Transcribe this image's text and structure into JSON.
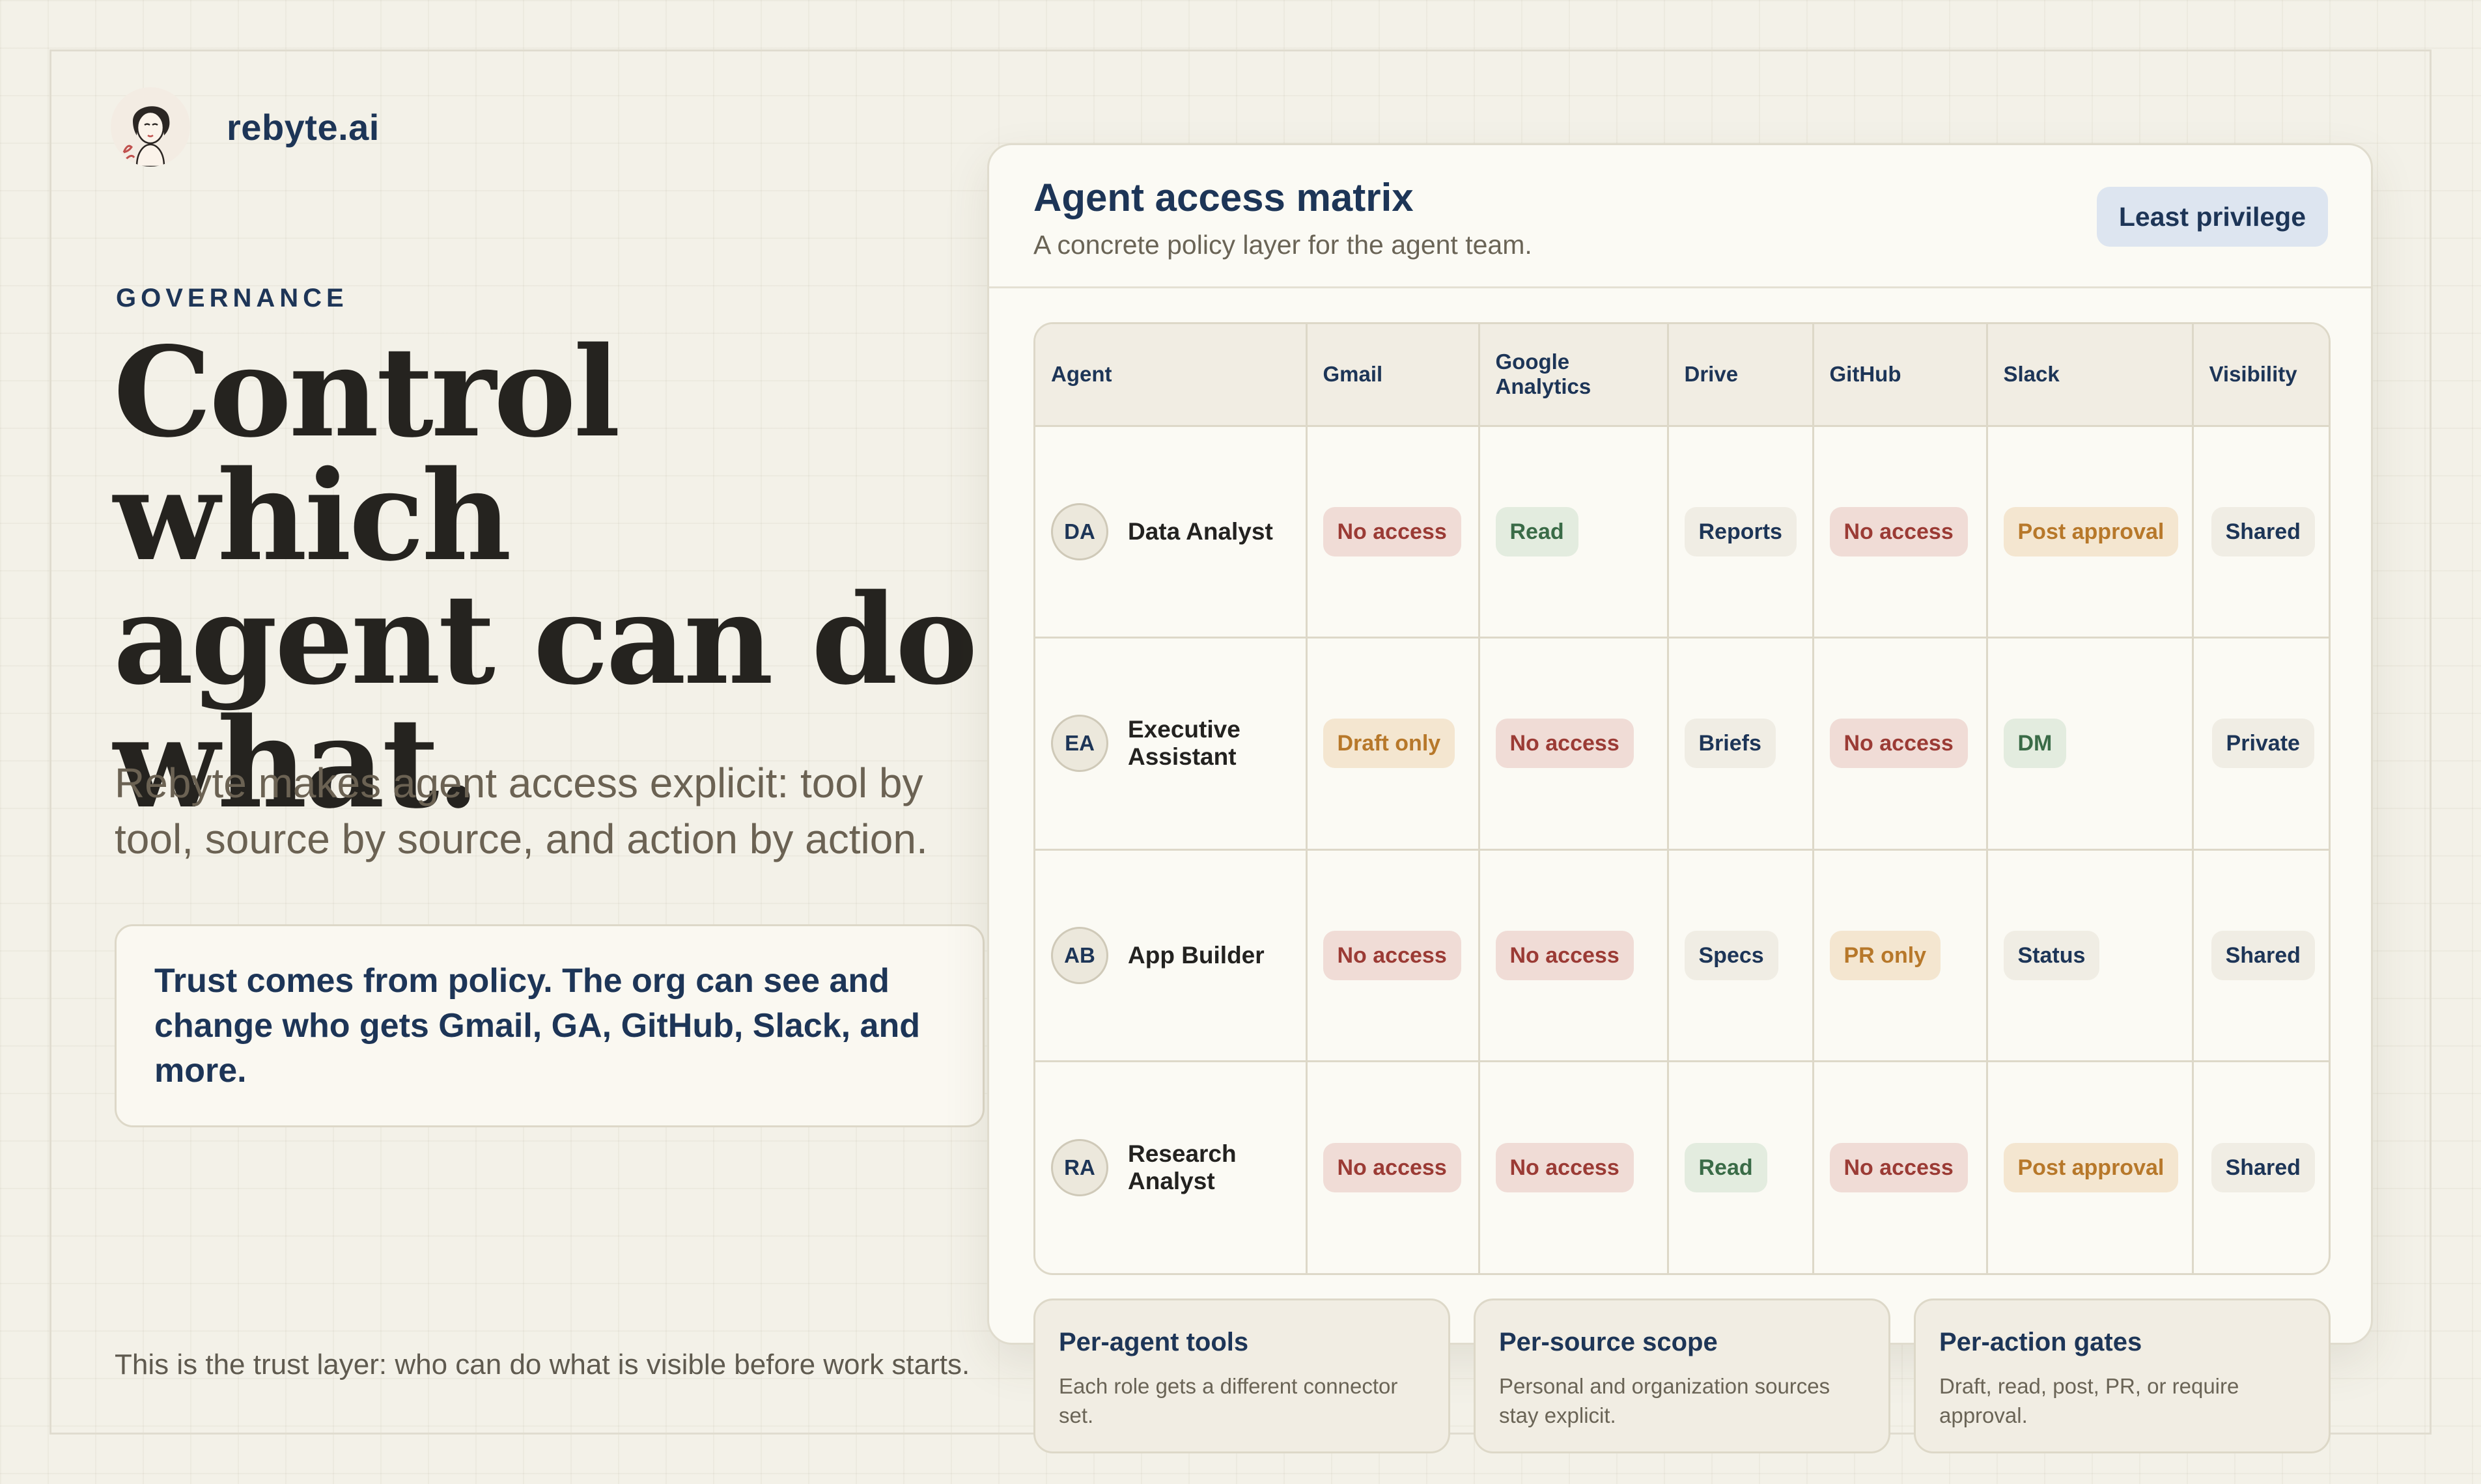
{
  "brand": {
    "name": "rebyte.ai"
  },
  "hero": {
    "eyebrow": "GOVERNANCE",
    "headline_lines": [
      "Control which",
      "agent can do",
      "what."
    ],
    "subhead": "Rebyte makes agent access explicit: tool by tool, source by source, and action by action.",
    "callout": "Trust comes from policy. The org can see and change who gets Gmail, GA, GitHub, Slack, and more.",
    "footnote": "This is the trust layer: who can do what is visible before work starts."
  },
  "card": {
    "title": "Agent access matrix",
    "subtitle": "A concrete policy layer for the agent team.",
    "badge": "Least privilege"
  },
  "matrix": {
    "headers": [
      "Agent",
      "Gmail",
      "Google Analytics",
      "Drive",
      "GitHub",
      "Slack",
      "Visibility"
    ],
    "rows": [
      {
        "initials": "DA",
        "name": "Data Analyst",
        "cells": [
          {
            "label": "No access",
            "tone": "red"
          },
          {
            "label": "Read",
            "tone": "green"
          },
          {
            "label": "Reports",
            "tone": "neutral"
          },
          {
            "label": "No access",
            "tone": "red"
          },
          {
            "label": "Post approval",
            "tone": "orange"
          },
          {
            "label": "Shared",
            "tone": "neutral"
          }
        ]
      },
      {
        "initials": "EA",
        "name": "Executive Assistant",
        "cells": [
          {
            "label": "Draft only",
            "tone": "orange"
          },
          {
            "label": "No access",
            "tone": "red"
          },
          {
            "label": "Briefs",
            "tone": "neutral"
          },
          {
            "label": "No access",
            "tone": "red"
          },
          {
            "label": "DM",
            "tone": "green"
          },
          {
            "label": "Private",
            "tone": "neutral"
          }
        ]
      },
      {
        "initials": "AB",
        "name": "App Builder",
        "cells": [
          {
            "label": "No access",
            "tone": "red"
          },
          {
            "label": "No access",
            "tone": "red"
          },
          {
            "label": "Specs",
            "tone": "neutral"
          },
          {
            "label": "PR only",
            "tone": "orange"
          },
          {
            "label": "Status",
            "tone": "neutral"
          },
          {
            "label": "Shared",
            "tone": "neutral"
          }
        ]
      },
      {
        "initials": "RA",
        "name": "Research Analyst",
        "cells": [
          {
            "label": "No access",
            "tone": "red"
          },
          {
            "label": "No access",
            "tone": "red"
          },
          {
            "label": "Read",
            "tone": "green"
          },
          {
            "label": "No access",
            "tone": "red"
          },
          {
            "label": "Post approval",
            "tone": "orange"
          },
          {
            "label": "Shared",
            "tone": "neutral"
          }
        ]
      }
    ]
  },
  "features": [
    {
      "title": "Per-agent tools",
      "desc": "Each role gets a different connector set."
    },
    {
      "title": "Per-source scope",
      "desc": "Personal and organization sources stay explicit."
    },
    {
      "title": "Per-action gates",
      "desc": "Draft, read, post, PR, or require approval."
    }
  ]
}
